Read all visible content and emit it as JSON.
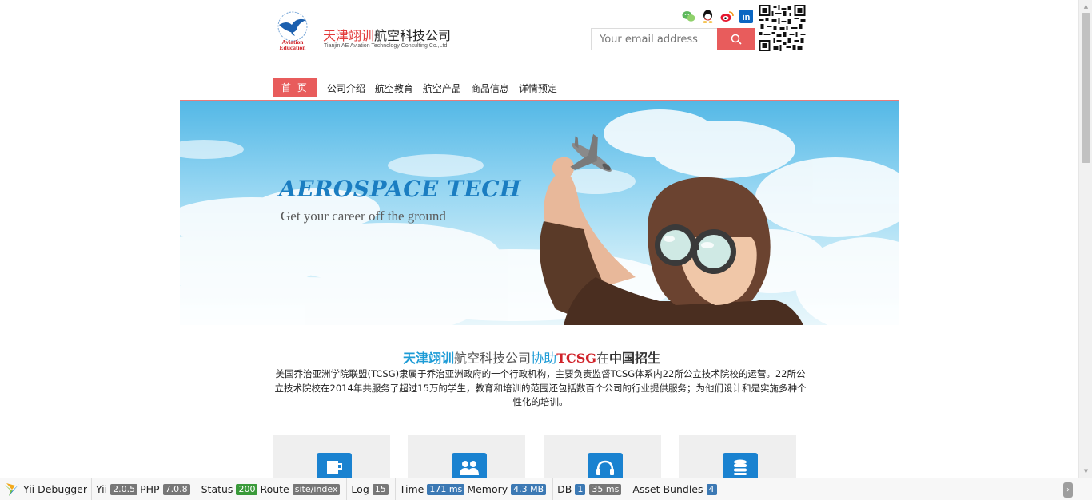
{
  "header": {
    "brand_cn_red": "天津翊训",
    "brand_cn_rest": "航空科技公司",
    "brand_en": "Tianjin AE Aviation Technology Consulting Co.,Ltd",
    "logo_text_line1": "Aviation",
    "logo_text_line2": "Education",
    "search_placeholder": "Your email address",
    "social_icons": [
      "wechat-icon",
      "qq-icon",
      "weibo-icon",
      "linkedin-icon"
    ],
    "linkedin_glyph": "in"
  },
  "nav": {
    "items": [
      "首 页",
      "公司介绍",
      "航空教育",
      "航空产品",
      "商品信息",
      "详情预定"
    ]
  },
  "banner": {
    "title": "AEROSPACE TECH",
    "subtitle": "Get your career off the ground"
  },
  "intro": {
    "title_part1": "天津翊训",
    "title_part2": "航空科技公司",
    "title_part3": "协助",
    "title_part4": "TCSG",
    "title_part5": "在",
    "title_part6": "中国招生",
    "body": "美国乔治亚洲学院联盟(TCSG)隶属于乔治亚洲政府的一个行政机构，主要负责监督TCSG体系内22所公立技术院校的运营。22所公立技术院校在2014年共服务了超过15万的学生，教育和培训的范围还包括数百个公司的行业提供服务；为他们设计和是实施多种个性化的培训。"
  },
  "cards": [
    {
      "icon": "cup-icon"
    },
    {
      "icon": "users-icon"
    },
    {
      "icon": "headset-icon"
    },
    {
      "icon": "database-icon"
    }
  ],
  "debugbar": {
    "debugger_label": "Yii Debugger",
    "yii_label": "Yii",
    "yii_version": "2.0.5",
    "php_label": "PHP",
    "php_version": "7.0.8",
    "status_label": "Status",
    "status_value": "200",
    "route_label": "Route",
    "route_value": "site/index",
    "log_label": "Log",
    "log_value": "15",
    "time_label": "Time",
    "time_value": "171 ms",
    "memory_label": "Memory",
    "memory_value": "4.3 MB",
    "db_label": "DB",
    "db_count": "1",
    "db_time": "35 ms",
    "assets_label": "Asset Bundles",
    "assets_value": "4",
    "toggle_glyph": "›"
  },
  "colors": {
    "accent": "#e85c5c",
    "blue": "#1c9bd6",
    "red": "#d0232a",
    "card_icon": "#1a82d0"
  }
}
